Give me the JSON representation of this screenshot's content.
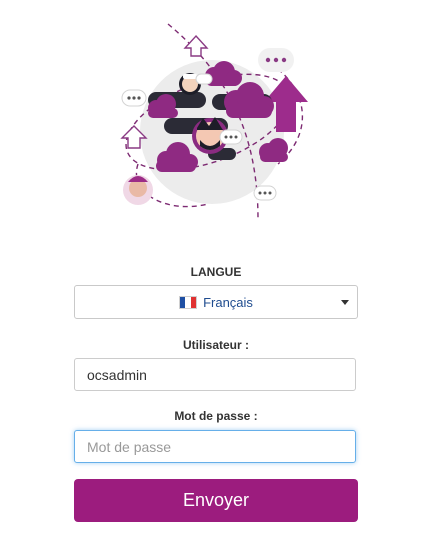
{
  "login": {
    "language_label": "LANGUE",
    "language_selected": "Français",
    "language_flag_colors": [
      "#1e4fa3",
      "#ffffff",
      "#e03232"
    ],
    "user_label": "Utilisateur :",
    "user_value": "ocsadmin",
    "password_label": "Mot de passe :",
    "password_placeholder": "Mot de passe",
    "submit_label": "Envoyer"
  },
  "colors": {
    "brand_purple": "#9c1c7e",
    "focus_blue": "#66afe9",
    "dark_cloud": "#2b2b36"
  },
  "illustration": {
    "icons": [
      "avatar-icon",
      "chat-bubble-icon",
      "cloud-icon",
      "arrow-up-icon",
      "orbit-path-icon"
    ]
  }
}
